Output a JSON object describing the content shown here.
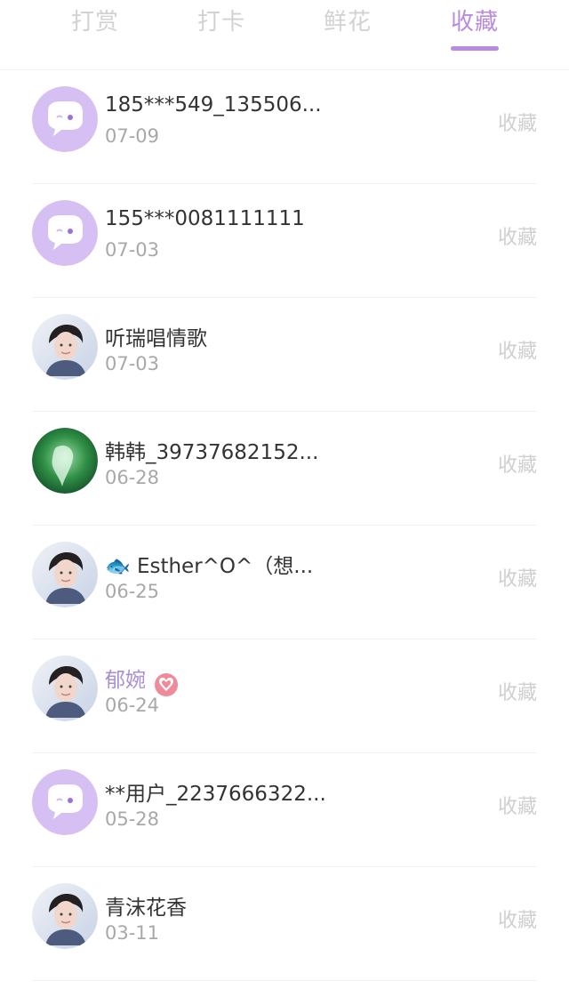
{
  "tabs": [
    {
      "label": "打赏",
      "active": false
    },
    {
      "label": "打卡",
      "active": false
    },
    {
      "label": "鲜花",
      "active": false
    },
    {
      "label": "收藏",
      "active": true
    }
  ],
  "colors": {
    "accent": "#b88be0",
    "inactive_tab": "#d2d2d2",
    "default_avatar_bg": "#d6bff2",
    "vip_name": "#a98ed8",
    "vip_badge": "#f08a9a"
  },
  "items": [
    {
      "name": "185***549_135506...",
      "date": "07-09",
      "action": "收藏",
      "avatar": "default-chat-avatar"
    },
    {
      "name": "155***0081111111",
      "date": "07-03",
      "action": "收藏",
      "avatar": "default-chat-avatar"
    },
    {
      "name": "听瑞唱情歌",
      "date": "07-03",
      "action": "收藏",
      "avatar": "user-photo-avatar"
    },
    {
      "name": "韩韩_39737682152...",
      "date": "06-28",
      "action": "收藏",
      "avatar": "green-photo-avatar"
    },
    {
      "name": "🐟 Esther^O^（想...",
      "date": "06-25",
      "action": "收藏",
      "avatar": "user-photo-avatar"
    },
    {
      "name": "郁婉",
      "date": "06-24",
      "action": "收藏",
      "avatar": "user-photo-avatar",
      "vip": true,
      "badge_icon": "vip-heart-icon"
    },
    {
      "name": "**用户_2237666322...",
      "date": "05-28",
      "action": "收藏",
      "avatar": "default-chat-avatar"
    },
    {
      "name": "青沫花香",
      "date": "03-11",
      "action": "收藏",
      "avatar": "user-photo-avatar"
    }
  ]
}
